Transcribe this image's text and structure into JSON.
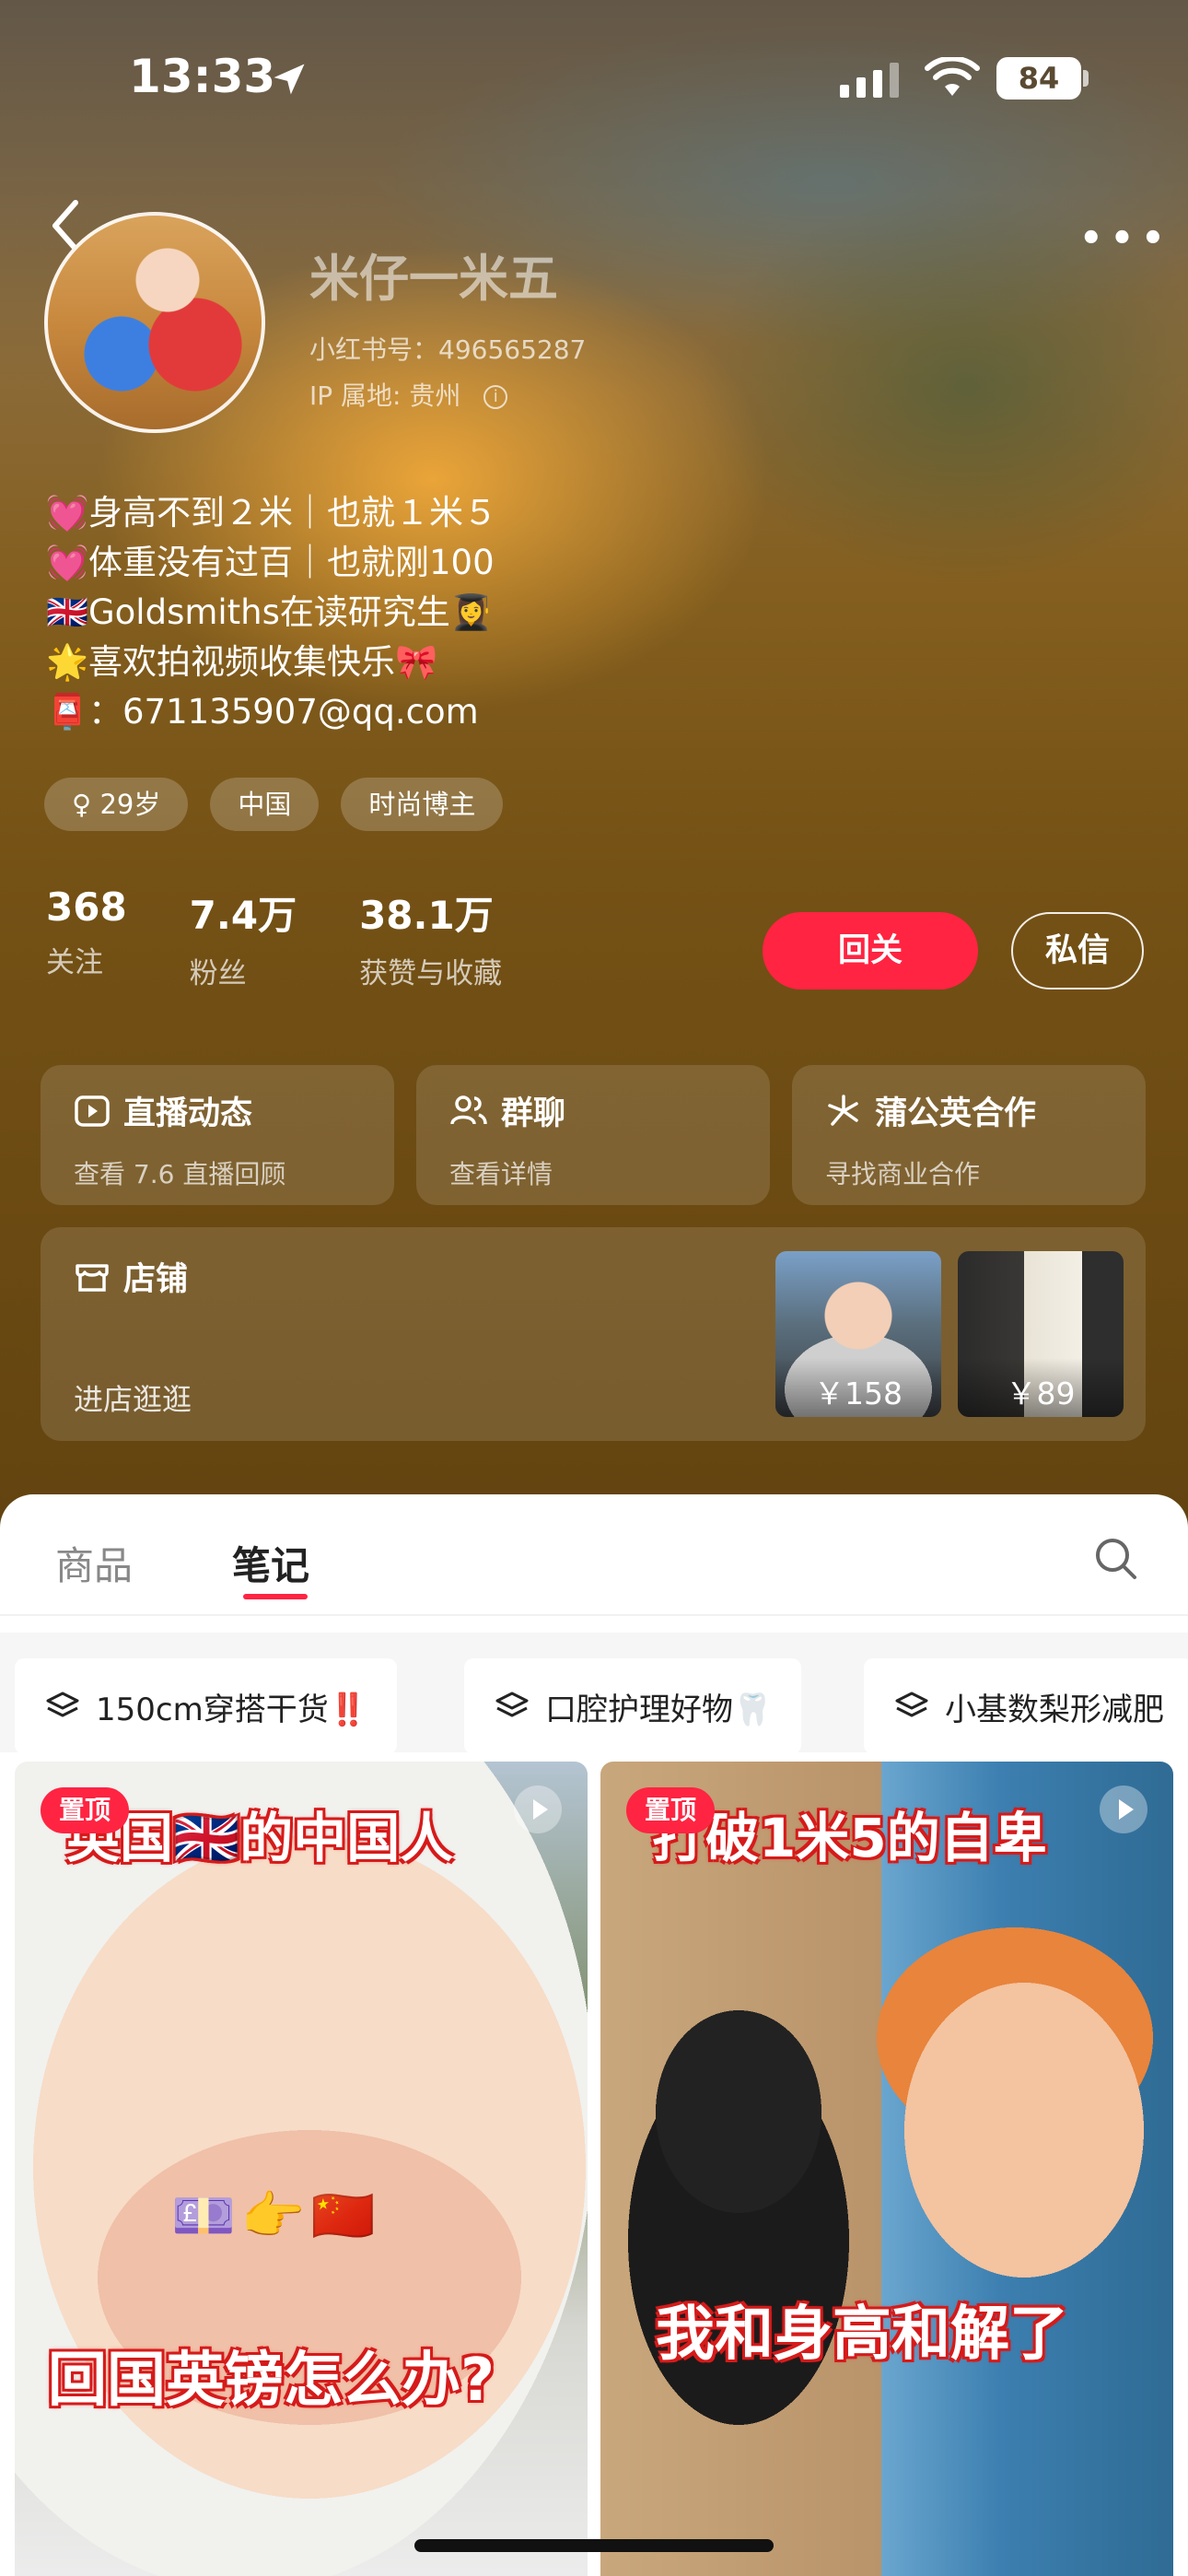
{
  "status_bar": {
    "time": "13:33",
    "battery": "84"
  },
  "profile": {
    "name": "米仔一米五",
    "red_id": "小红书号：496565287",
    "ip": "IP 属地: 贵州",
    "bio": [
      {
        "emoji": "💓",
        "text": "身高不到２米｜也就１米５"
      },
      {
        "emoji": "💓",
        "text": "体重没有过百｜也就刚100"
      },
      {
        "emoji": "🇬🇧",
        "text": "Goldsmiths在读研究生👩‍🎓"
      },
      {
        "emoji": "🌟",
        "text": "喜欢拍视频收集快乐🎀"
      },
      {
        "emoji": "📮",
        "text": "：671135907@qq.com"
      }
    ],
    "tags": [
      "♀ 29岁",
      "中国",
      "时尚博主"
    ],
    "stats": [
      {
        "num": "368",
        "label": "关注"
      },
      {
        "num": "7.4万",
        "label": "粉丝"
      },
      {
        "num": "38.1万",
        "label": "获赞与收藏"
      }
    ],
    "follow_label": "回关",
    "message_label": "私信"
  },
  "cards": [
    {
      "icon": "live-icon",
      "title": "直播动态",
      "sub": "查看 7.6 直播回顾"
    },
    {
      "icon": "group-icon",
      "title": "群聊",
      "sub": "查看详情"
    },
    {
      "icon": "dandelion-icon",
      "title": "蒲公英合作",
      "sub": "寻找商业合作"
    }
  ],
  "shop": {
    "title": "店铺",
    "sub": "进店逛逛",
    "prices": [
      "￥158",
      "￥89"
    ]
  },
  "tabs": {
    "items": [
      "商品",
      "笔记"
    ],
    "active": "笔记"
  },
  "collections": [
    {
      "text": "150cm穿搭干货‼️"
    },
    {
      "text": "口腔护理好物🦷"
    },
    {
      "text": "小基数梨形减肥"
    }
  ],
  "notes": [
    {
      "pin": "置顶",
      "top_caption": "英国🇬🇧的中国人",
      "mid_emoji": "💷👉🇨🇳",
      "bottom_caption": "回国英镑怎么办?"
    },
    {
      "pin": "置顶",
      "top_caption": "打破1米5的自卑",
      "mid_emoji": "",
      "bottom_caption": "我和身高和解了"
    }
  ],
  "colors": {
    "accent": "#ff2442",
    "hero": "#7a5516"
  }
}
